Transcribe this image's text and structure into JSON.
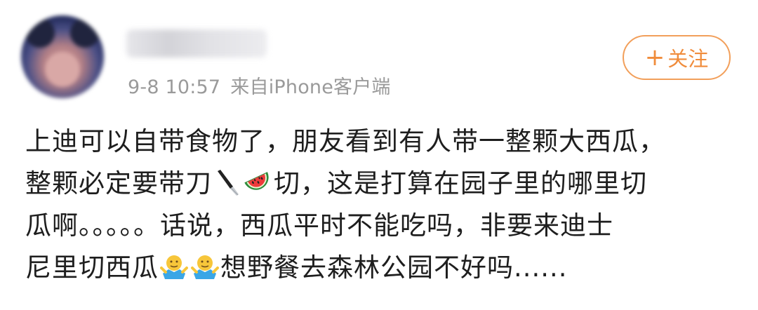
{
  "post": {
    "timestamp": "9-8 10:57",
    "source": "来自iPhone客户端",
    "follow_button": {
      "icon": "plus-icon",
      "label": "关注",
      "color": "#f08c3b"
    },
    "content_lines": [
      [
        "上迪可以自带食物了，朋友看到有人带一整颗大西瓜，"
      ],
      [
        "整颗必定要带刀",
        "切，这是打算在园子里的哪里切"
      ],
      [
        "瓜啊。。。。。话说，西瓜平时不能吃吗，非要来迪士"
      ],
      [
        "尼里切西瓜",
        "想野餐去森林公园不好吗......"
      ]
    ],
    "emojis": [
      "knife-emoji",
      "watermelon-emoji",
      "shrug-emoji",
      "shrug-emoji"
    ]
  }
}
